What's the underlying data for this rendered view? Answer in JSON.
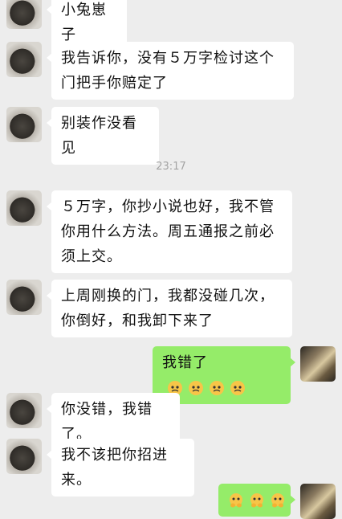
{
  "messages": [
    {
      "side": "left",
      "text": "小兔崽子"
    },
    {
      "side": "left",
      "text": "我告诉你，没有５万字检讨这个门把手你赔定了"
    },
    {
      "side": "left",
      "text": "别装作没看见"
    },
    {
      "type": "time",
      "text": "23:17"
    },
    {
      "side": "left",
      "text": "５万字，你抄小说也好，我不管你用什么方法。周五通报之前必须上交。"
    },
    {
      "side": "left",
      "text": "上周刚换的门，我都没碰几次，你倒好，和我卸下来了"
    },
    {
      "side": "right",
      "text": "我错了",
      "emoji": "pleading-face-icon",
      "emoji_count": 4
    },
    {
      "side": "left",
      "text": "你没错，我错了。"
    },
    {
      "side": "left",
      "text": "我不该把你招进来。"
    },
    {
      "side": "right",
      "text": "",
      "emoji": "pleading-hands-face-icon",
      "emoji_count": 3
    }
  ],
  "colors": {
    "background": "#ededed",
    "bubble_self": "#95ec69",
    "bubble_other": "#ffffff",
    "time_text": "#a3a3a3"
  }
}
